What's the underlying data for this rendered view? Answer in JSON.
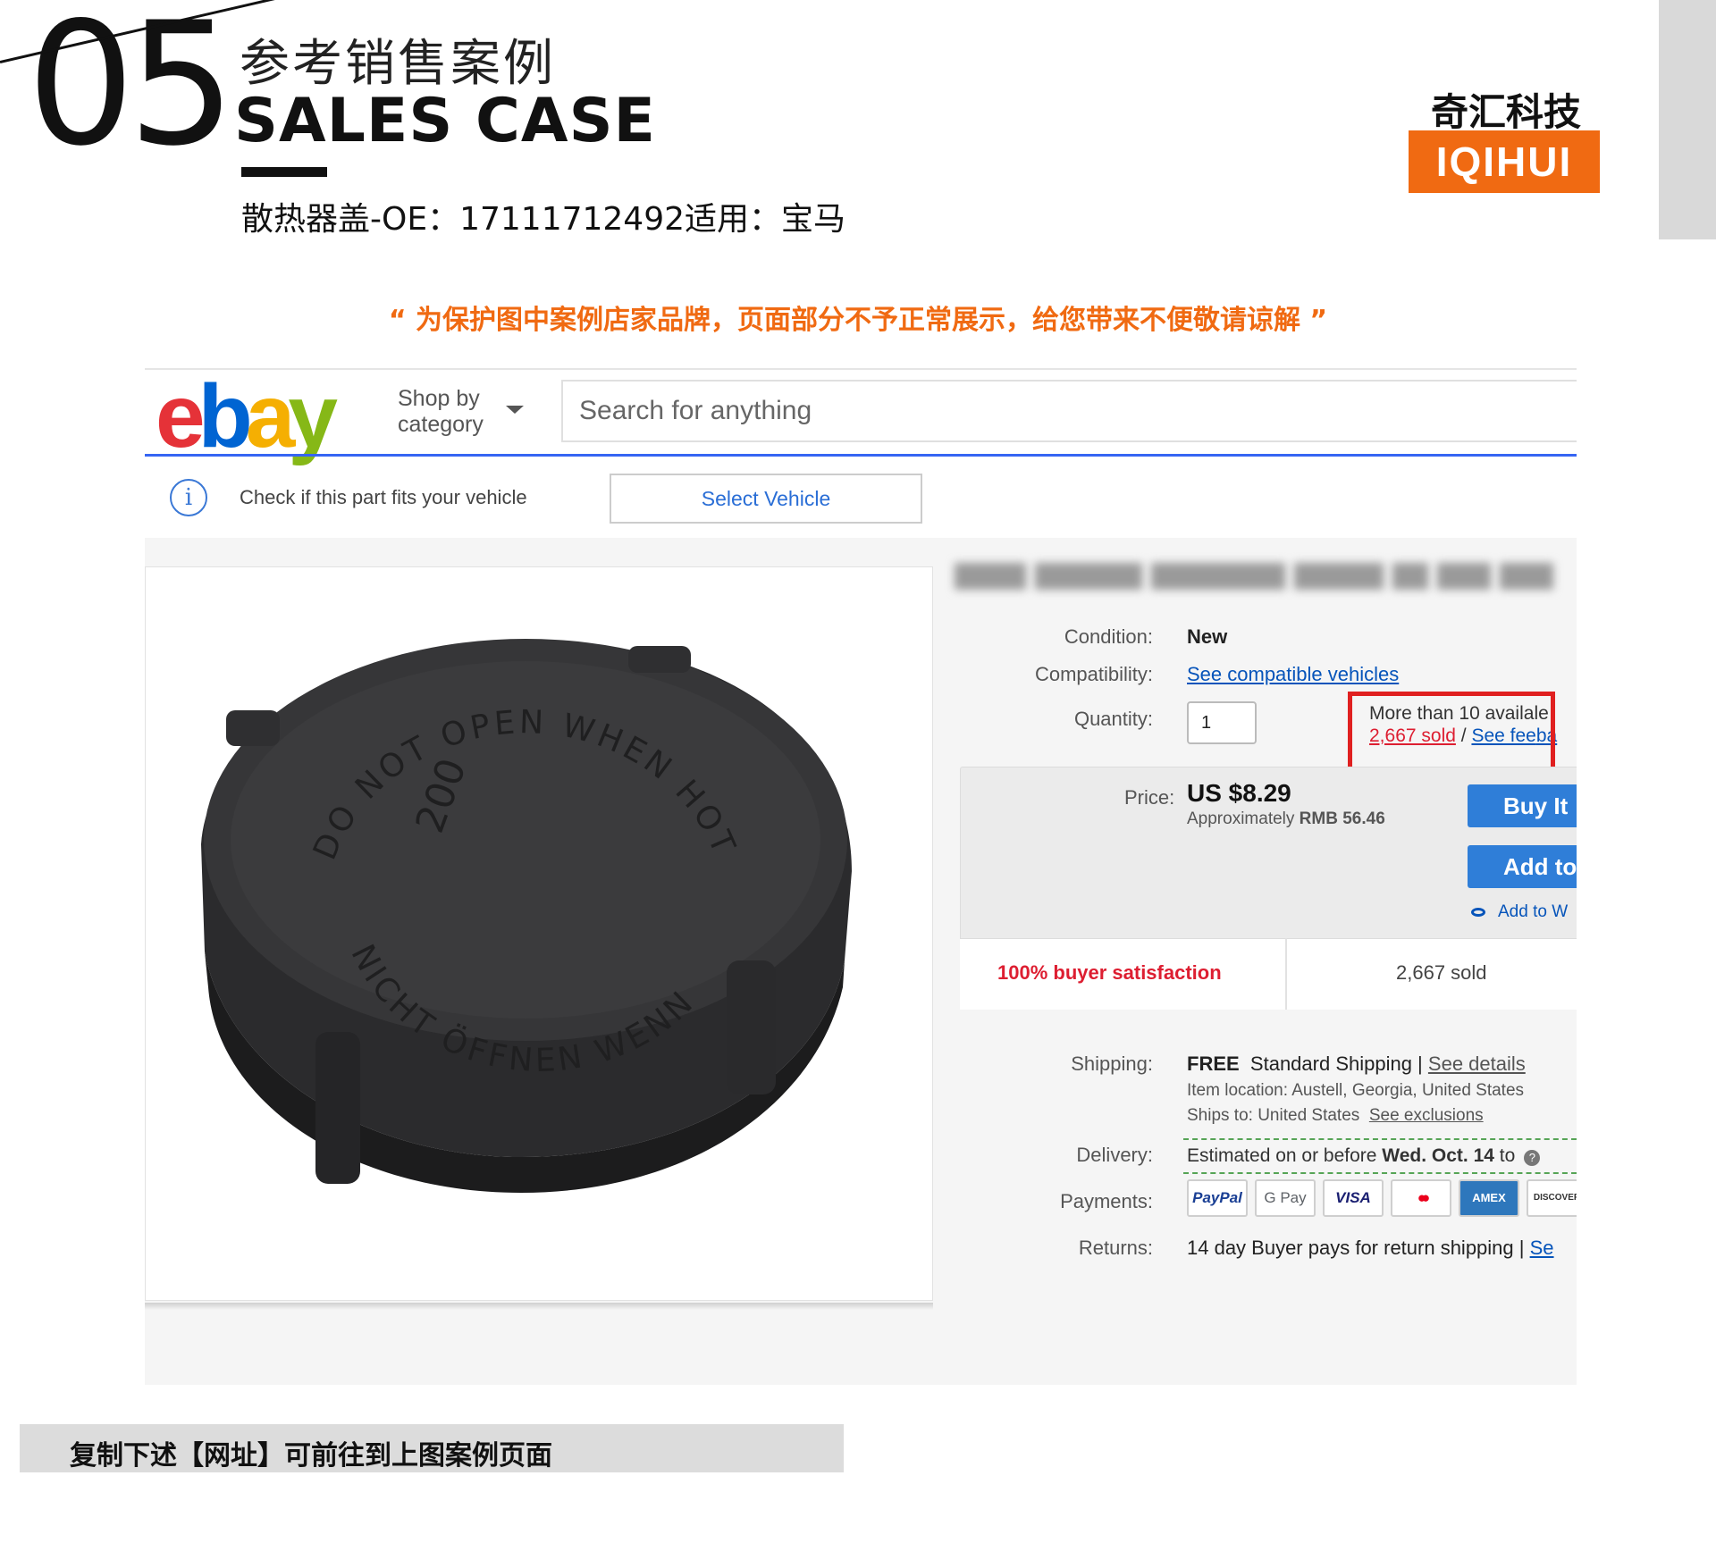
{
  "header": {
    "number": "05",
    "title_cn": "参考销售案例",
    "title_en": "SALES CASE",
    "subtitle": "散热器盖-OE：17111712492适用：宝马"
  },
  "brand": {
    "name_cn": "奇汇科技",
    "name_en": "IQIHUI",
    "accent_color": "#f06a12"
  },
  "notice": "“ 为保护图中案例店家品牌，页面部分不予正常展示，给您带来不便敬请谅解 ”",
  "ebay": {
    "logo": {
      "e": "e",
      "b": "b",
      "a": "a",
      "y": "y"
    },
    "shop_by": "Shop by",
    "category": "category",
    "search_placeholder": "Search for anything",
    "fit_check": "Check if this part fits your vehicle",
    "select_vehicle": "Select Vehicle",
    "condition_label": "Condition:",
    "condition_value": "New",
    "compat_label": "Compatibility:",
    "compat_link": "See compatible vehicles",
    "quantity_label": "Quantity:",
    "quantity_value": "1",
    "availability": "More than 10 availa",
    "availability_cut": "le",
    "sold_link": "2,667 sold",
    "sep": "/",
    "feedback_link": "See fee",
    "feedback_cut": "ba",
    "price_label": "Price:",
    "price_value": "US $8.29",
    "approx_prefix": "Approximately",
    "approx_value": "RMB 56.46",
    "buy_label": "Buy It",
    "add_cart_label": "Add to",
    "watch_label": "Add to W",
    "satisfaction": "100% buyer satisfaction",
    "sold_count": "2,667 sold",
    "shipping_label": "Shipping:",
    "shipping_free": "FREE",
    "shipping_type": "Standard Shipping |",
    "shipping_details": "See details",
    "item_location": "Item location:  Austell, Georgia, United States",
    "ships_to": "Ships to:  United States",
    "ships_exclusions": "See exclusions",
    "delivery_label": "Delivery:",
    "delivery_text": "Estimated on or before",
    "delivery_date": "Wed. Oct. 14",
    "delivery_to": "to",
    "payments_label": "Payments:",
    "payments": [
      "PayPal",
      "G Pay",
      "VISA",
      "●●",
      "AMEX",
      "DISCOVER"
    ],
    "returns_label": "Returns:",
    "returns_text": "14 day Buyer pays for return shipping |",
    "returns_link": "Se",
    "product_text_outer_1": "DO NOT OPEN WHEN HOT",
    "product_text_outer_2": "NICHT ÖFFNEN WENN HEISS",
    "product_pressure": "200"
  },
  "footer": {
    "copy_hint": "复制下述【网址】可前往到上图案例页面"
  }
}
